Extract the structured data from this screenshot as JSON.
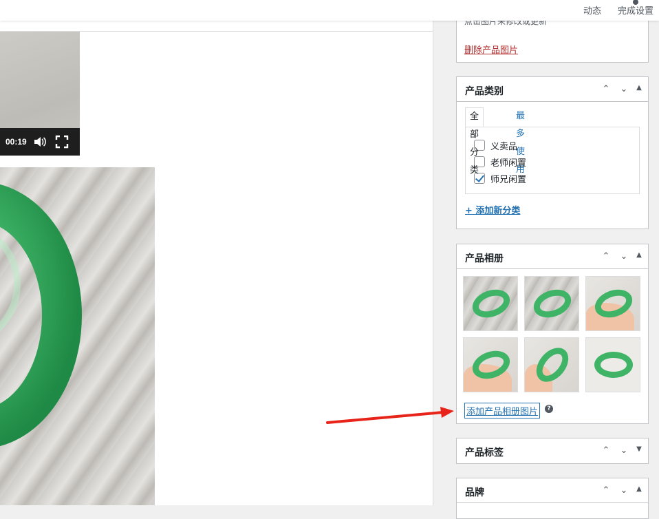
{
  "topbar": {
    "activity_label": "动态",
    "finish_setup_label": "完成设置"
  },
  "video": {
    "time": "00:19",
    "icons": [
      "volume-icon",
      "fullscreen-icon"
    ]
  },
  "product_image_box": {
    "hint_text": "点击图片来修改或更新",
    "remove_link": "删除产品图片"
  },
  "category_box": {
    "title": "产品类别",
    "tabs": [
      {
        "label": "全部分类",
        "active": true
      },
      {
        "label": "最多使用",
        "active": false
      }
    ],
    "categories": [
      {
        "label": "义卖品",
        "checked": false
      },
      {
        "label": "老师闲置",
        "checked": false
      },
      {
        "label": "师兄闲置",
        "checked": true
      }
    ],
    "add_new_link": "+ 添加新分类"
  },
  "gallery_box": {
    "title": "产品相册",
    "images": [
      {
        "alt": "bangle-1"
      },
      {
        "alt": "bangle-2"
      },
      {
        "alt": "bangle-3"
      },
      {
        "alt": "bangle-4"
      },
      {
        "alt": "bangle-5"
      },
      {
        "alt": "bangle-6"
      }
    ],
    "add_link": "添加产品相册图片",
    "help_glyph": "?"
  },
  "tags_box": {
    "title": "产品标签"
  },
  "brand_box": {
    "title": "品牌"
  },
  "colors": {
    "link": "#2271b1",
    "danger_link": "#b32d2e",
    "annotation_arrow": "#e8231a"
  }
}
